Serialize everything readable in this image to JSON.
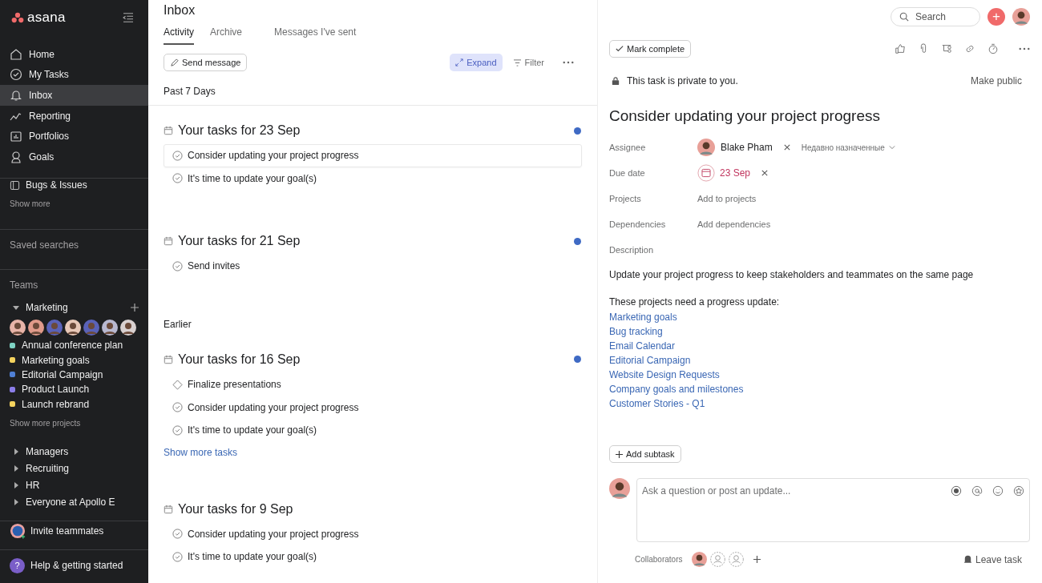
{
  "sidebar": {
    "logo": "asana",
    "nav": [
      {
        "label": "Home",
        "selected": false
      },
      {
        "label": "My Tasks",
        "selected": false
      },
      {
        "label": "Inbox",
        "selected": true
      },
      {
        "label": "Reporting",
        "selected": false
      },
      {
        "label": "Portfolios",
        "selected": false
      },
      {
        "label": "Goals",
        "selected": false
      }
    ],
    "starred": [
      {
        "label": "Bugs & Issues"
      }
    ],
    "show_more": "Show more",
    "saved_searches": "Saved searches",
    "teams_heading": "Teams",
    "teams": [
      {
        "name": "Marketing",
        "expanded": true,
        "projects": [
          {
            "name": "Annual conference plan",
            "color": "#7ed3c4"
          },
          {
            "name": "Marketing goals",
            "color": "#f4d35e"
          },
          {
            "name": "Editorial Campaign",
            "color": "#4f7fd4"
          },
          {
            "name": "Product Launch",
            "color": "#8b7de8"
          },
          {
            "name": "Launch rebrand",
            "color": "#f4d35e"
          }
        ],
        "show_more": "Show more projects"
      },
      {
        "name": "Managers",
        "expanded": false
      },
      {
        "name": "Recruiting",
        "expanded": false
      },
      {
        "name": "HR",
        "expanded": false
      },
      {
        "name": "Everyone at Apollo E",
        "expanded": false
      }
    ],
    "invite": "Invite teammates",
    "help": {
      "icon": "?",
      "label": "Help & getting started"
    }
  },
  "topbar": {
    "search_placeholder": "Search",
    "add_icon": "+"
  },
  "inbox": {
    "title": "Inbox",
    "tabs": [
      {
        "label": "Activity",
        "selected": true
      },
      {
        "label": "Archive",
        "selected": false
      },
      {
        "label": "Messages I've sent",
        "selected": false
      }
    ],
    "send_message": "Send message",
    "expand": {
      "label": "Expand",
      "active": true
    },
    "filter": "Filter",
    "sections": [
      {
        "heading": "Past 7 Days",
        "groups": [
          {
            "title": "Your tasks for 23 Sep",
            "unread": true,
            "tasks": [
              {
                "name": "Consider updating your project progress",
                "kind": "task",
                "selected": true
              },
              {
                "name": "It's time to update your goal(s)",
                "kind": "task",
                "selected": false
              }
            ]
          },
          {
            "title": "Your tasks for 21 Sep",
            "unread": true,
            "tasks": [
              {
                "name": "Send invites",
                "kind": "task",
                "selected": false
              }
            ]
          }
        ]
      },
      {
        "heading": "Earlier",
        "groups": [
          {
            "title": "Your tasks for 16 Sep",
            "unread": true,
            "tasks": [
              {
                "name": "Finalize presentations",
                "kind": "milestone",
                "selected": false
              },
              {
                "name": "Consider updating your project progress",
                "kind": "task",
                "selected": false
              },
              {
                "name": "It's time to update your goal(s)",
                "kind": "task",
                "selected": false
              }
            ],
            "show_more": "Show more tasks"
          },
          {
            "title": "Your tasks for 9 Sep",
            "unread": false,
            "tasks": [
              {
                "name": "Consider updating your project progress",
                "kind": "task",
                "selected": false
              },
              {
                "name": "It's time to update your goal(s)",
                "kind": "task",
                "selected": false
              }
            ]
          }
        ]
      }
    ]
  },
  "task": {
    "mark_complete": "Mark complete",
    "private_note": "This task is private to you.",
    "make_public": "Make public",
    "title": "Consider updating your project progress",
    "fields": [
      {
        "label": "Assignee",
        "kind": "person",
        "value": "Blake Pham",
        "extra": "Недавно назначенные"
      },
      {
        "label": "Due date",
        "kind": "date",
        "value": "23 Sep"
      },
      {
        "label": "Projects",
        "kind": "add",
        "value": "Add to projects"
      },
      {
        "label": "Dependencies",
        "kind": "add",
        "value": "Add dependencies"
      },
      {
        "label": "Description",
        "kind": "label"
      }
    ],
    "description": "Update your project progress to keep stakeholders and teammates on the same page",
    "projects_intro": "These projects need a progress update:",
    "project_links": [
      "Marketing goals",
      "Bug tracking",
      "Email Calendar",
      "Editorial Campaign",
      "Website Design Requests",
      "Company goals and milestones",
      "Customer Stories - Q1"
    ],
    "add_subtask": "Add subtask",
    "comment_placeholder": "Ask a question or post an update...",
    "collaborators": "Collaborators",
    "leave_task": "Leave task"
  }
}
